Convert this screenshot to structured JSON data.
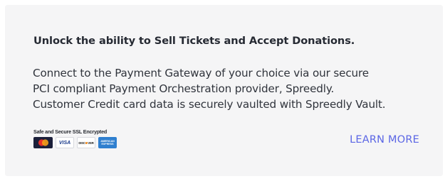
{
  "card": {
    "heading": "Unlock the ability to Sell Tickets and Accept Donations.",
    "body_lines": [
      "Connect to the Payment Gateway of your choice via our secure",
      "PCI compliant Payment Orchestration provider, Spreedly.",
      "Customer Credit card data is securely vaulted with Spreedly Vault."
    ],
    "ssl_label": "Safe and Secure SSL Encrypted",
    "payment_cards": [
      {
        "name": "mastercard",
        "label": ""
      },
      {
        "name": "visa",
        "label": "VISA"
      },
      {
        "name": "discover",
        "label": "DISC VER"
      },
      {
        "name": "american-express",
        "label": "AMERICAN EXPRESS"
      }
    ],
    "learn_more_label": "LEARN MORE"
  },
  "colors": {
    "card_background": "#f5f5f6",
    "heading": "#262a33",
    "body_text": "#30343c",
    "link": "#5b66e5",
    "mastercard_bg": "#1b1f3a",
    "amex_bg": "#2f7fcf"
  }
}
